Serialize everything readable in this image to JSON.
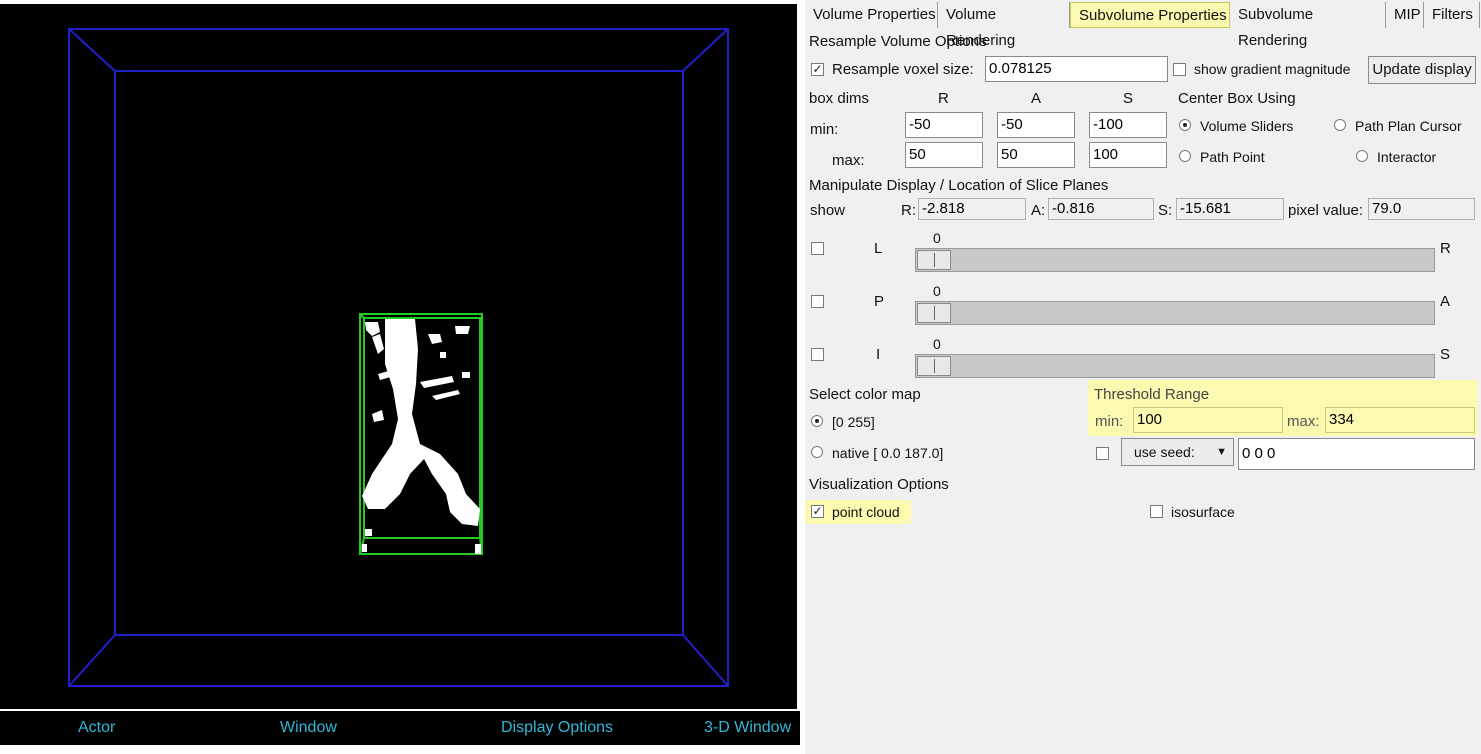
{
  "bottom_bar": {
    "actor": "Actor",
    "window": "Window",
    "display_options": "Display Options",
    "three_d_window": "3-D Window"
  },
  "tabs": [
    "Volume Properties",
    "Volume Rendering",
    "Subvolume Properties",
    "Subvolume Rendering",
    "MIP",
    "Filters"
  ],
  "active_tab": "Subvolume Properties",
  "resample": {
    "heading": "Resample Volume Options",
    "checkbox_label": "Resample voxel size:",
    "voxel_size": "0.078125",
    "show_gradient_label": "show gradient magnitude",
    "update_button": "Update display"
  },
  "box_dims": {
    "label": "box dims",
    "col_r": "R",
    "col_a": "A",
    "col_s": "S",
    "min_label": "min:",
    "max_label": "max:",
    "min": [
      "-50",
      "-50",
      "-100"
    ],
    "max": [
      "50",
      "50",
      "100"
    ]
  },
  "center_box": {
    "heading": "Center Box Using",
    "volume_sliders": "Volume Sliders",
    "path_plan_cursor": "Path Plan Cursor",
    "path_point": "Path Point",
    "interactor": "Interactor",
    "selected": "Volume Sliders"
  },
  "manipulate": {
    "heading": "Manipulate Display / Location of Slice Planes",
    "show_label": "show",
    "r_label": "R:",
    "r_value": "-2.818",
    "a_label": "A:",
    "a_value": "-0.816",
    "s_label": "S:",
    "s_value": "-15.681",
    "pixel_label": "pixel value:",
    "pixel_value": "79.0"
  },
  "sliders": [
    {
      "left": "L",
      "right": "R",
      "value": "0"
    },
    {
      "left": "P",
      "right": "A",
      "value": "0"
    },
    {
      "left": "I",
      "right": "S",
      "value": "0"
    }
  ],
  "color_map": {
    "heading": "Select color map",
    "option1": "[0 255]",
    "option2": "native [ 0.0 187.0]",
    "selected": "[0 255]"
  },
  "threshold": {
    "heading": "Threshold Range",
    "min_label": "min:",
    "min_value": "100",
    "max_label": "max:",
    "max_value": "334",
    "seed_button": "use seed:",
    "seed_value": "0 0 0"
  },
  "viz": {
    "heading": "Visualization Options",
    "point_cloud": "point cloud",
    "isosurface": "isosurface"
  },
  "colors": {
    "highlight": "#fbfab0",
    "bottom_text": "#2fb8d8",
    "outer_box": "#2020c8",
    "inner_box": "#22cc22"
  }
}
